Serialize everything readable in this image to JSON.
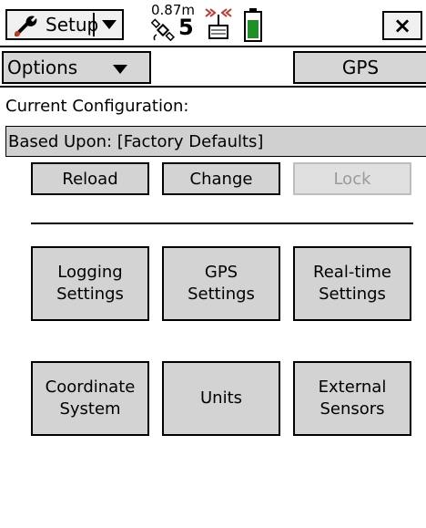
{
  "topbar": {
    "app_label": "Setup",
    "precision": "0.87m",
    "satellite_count": "5",
    "close_label": "×",
    "battery_color": "#1f8f2a"
  },
  "menu": {
    "options_label": "Options",
    "gps_tab_label": "GPS"
  },
  "config": {
    "heading": "Current Configuration:",
    "based_upon": "Based Upon: [Factory Defaults]"
  },
  "actions": {
    "reload": "Reload",
    "change": "Change",
    "lock": "Lock"
  },
  "settings_buttons": {
    "logging": "Logging\nSettings",
    "gps": "GPS\nSettings",
    "realtime": "Real-time\nSettings",
    "coordinate": "Coordinate\nSystem",
    "units": "Units",
    "external": "External\nSensors"
  }
}
